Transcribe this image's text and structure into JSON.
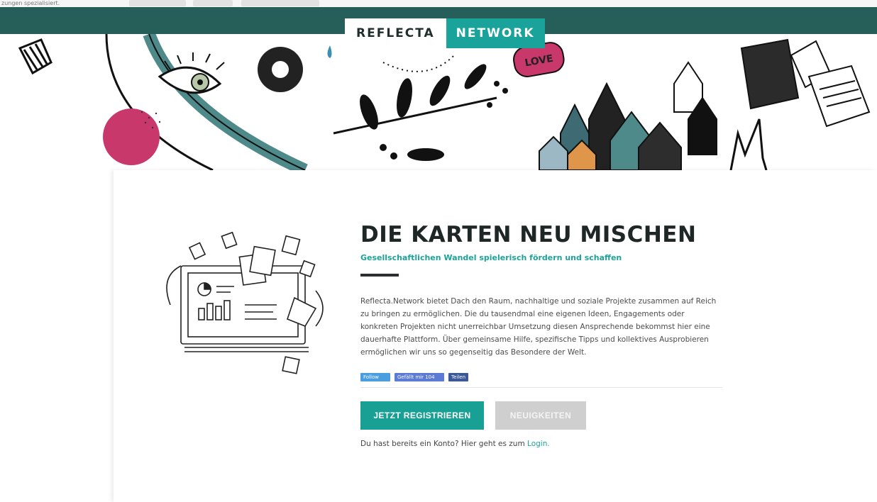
{
  "background": {
    "top_strip_text": "zungen spezialisiert."
  },
  "brand": {
    "part1": "REFLECTA",
    "part2": "NETWORK",
    "colors": {
      "teal": "#1aa39a",
      "dark_teal": "#265f5a",
      "pink": "#c9386a"
    }
  },
  "banner": {
    "love_sign": "LOVE"
  },
  "hero": {
    "title": "DIE KARTEN NEU MISCHEN",
    "subtitle": "Gesellschaftlichen Wandel spielerisch fördern und schaffen",
    "body": "Reflecta.Network bietet Dach den Raum, nachhaltige und soziale Projekte zusammen auf Reich zu bringen zu ermöglichen. Die du tausendmal eine eigenen Ideen, Engagements oder konkreten Projekten nicht unerreichbar Umsetzung diesen Ansprechende bekommst hier eine dauerhafte Plattform. Über gemeinsame Hilfe, spezifische Tipps und kollektives Ausprobieren ermöglichen wir uns so gegenseitig das Besondere der Welt.",
    "social": {
      "follow": "Follow",
      "like": "Gefällt mir 104",
      "share": "Teilen"
    },
    "primary_button": "JETZT REGISTRIEREN",
    "secondary_button": "NEUIGKEITEN",
    "login_prefix": "Du hast bereits ein Konto? Hier geht es zum ",
    "login_link": "Login."
  }
}
